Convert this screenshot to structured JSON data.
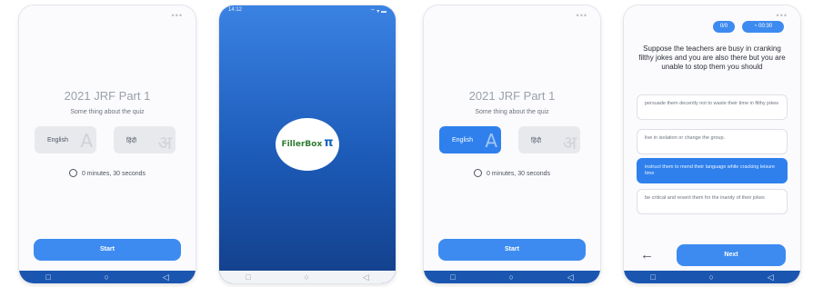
{
  "colors": {
    "accent": "#3d8bf0",
    "navbar": "#1a56b0",
    "splash_top": "#3a82e3",
    "splash_bottom": "#133f8a"
  },
  "screen1": {
    "title": "2021 JRF Part 1",
    "subtitle": "Some thing about the quiz",
    "lang_english": "English",
    "lang_hindi": "हिंदी",
    "glyph_en": "A",
    "glyph_hi": "अ",
    "timer": "0 minutes, 30 seconds",
    "start": "Start",
    "selected_language": ""
  },
  "screen2": {
    "status_time": "14:12",
    "status_right": "⌔ ▾ ▬",
    "logo_text": "FillerBox",
    "logo_mark": "π"
  },
  "screen3": {
    "title": "2021 JRF Part 1",
    "subtitle": "Some thing about the quiz",
    "lang_english": "English",
    "lang_hindi": "हिंदी",
    "glyph_en": "A",
    "glyph_hi": "अ",
    "timer": "0 minutes, 30 seconds",
    "start": "Start",
    "selected_language": "English"
  },
  "screen4": {
    "progress": "0/0",
    "timer": "00:30",
    "question": "Suppose the teachers are busy in cranking filthy jokes and you are also there but you are unable to stop them you should",
    "options": [
      "persuade them decently not to waste their time in filthy jokes",
      "live in isolation or change the group.",
      "instruct them to mend their language while cracking leisure time",
      "be critical and resent them for the inanity of their jokes"
    ],
    "selected_option": 2,
    "back_icon": "←",
    "next": "Next"
  },
  "nav_icons": {
    "back": "◁",
    "home": "○",
    "recent": "□"
  }
}
